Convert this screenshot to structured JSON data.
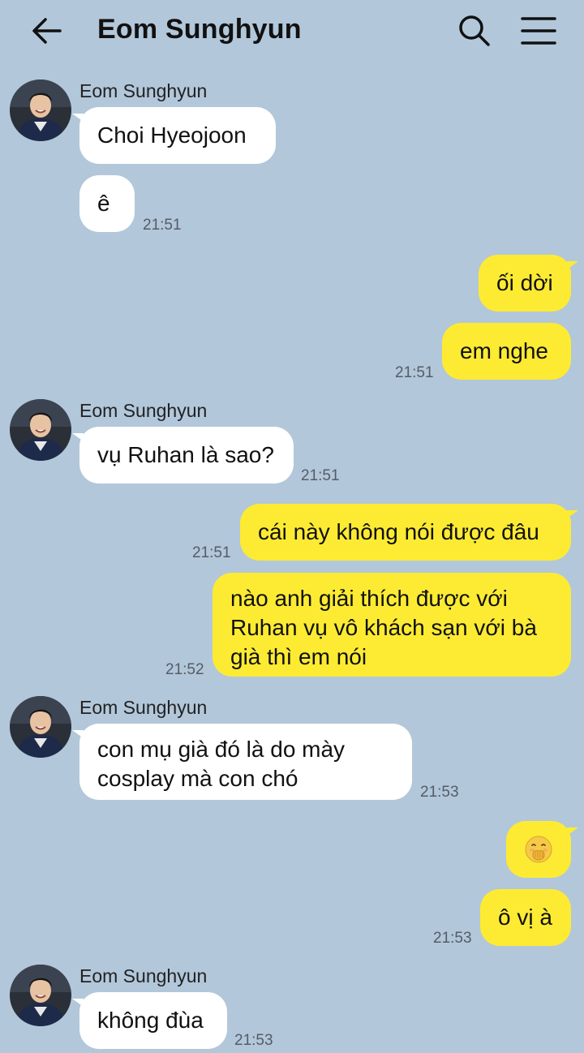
{
  "header": {
    "title": "Eom Sunghyun",
    "back_icon": "arrow-left-icon",
    "search_icon": "search-icon",
    "menu_icon": "hamburger-menu-icon"
  },
  "colors": {
    "background": "#b2c7da",
    "incoming_bubble": "#ffffff",
    "outgoing_bubble": "#fdeb33"
  },
  "messages": {
    "g1": {
      "sender": "Eom Sunghyun",
      "m1": "Choi Hyeojoon",
      "m2": "ê",
      "time": "21:51"
    },
    "o1": {
      "m1": "ối dời",
      "m2": "em nghe",
      "time": "21:51"
    },
    "g2": {
      "sender": "Eom Sunghyun",
      "m1": "vụ Ruhan là sao?",
      "time": "21:51"
    },
    "o2": {
      "m1": "cái này không nói được đâu",
      "m1_time": "21:51",
      "m2_line1": "nào anh giải thích được với",
      "m2_line2": "Ruhan vụ vô khách sạn với bà",
      "m2_line3": "già thì em nói",
      "m2_time": "21:52"
    },
    "g3": {
      "sender": "Eom Sunghyun",
      "m1_line1": "con mụ già đó là do mày",
      "m1_line2": "cosplay mà con chó",
      "time": "21:53"
    },
    "o3": {
      "m1_emoji": "face-with-hand-over-mouth-emoji",
      "m2": "ô vị à",
      "time": "21:53"
    },
    "g4": {
      "sender": "Eom Sunghyun",
      "m1": "không đùa",
      "time": "21:53"
    }
  }
}
